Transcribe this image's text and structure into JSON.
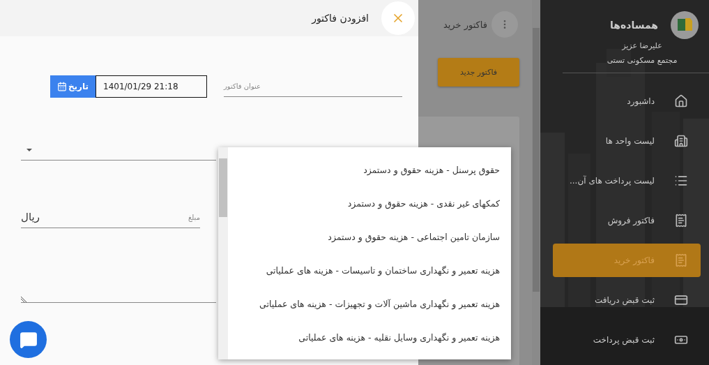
{
  "drawer": {
    "title": "افزودن فاکتور",
    "title_field": {
      "placeholder": "عنوان فاکتور"
    },
    "date_field": {
      "value": "1401/01/29 21:18",
      "button": "تاریخ"
    },
    "amount_field": {
      "label": "مبلغ",
      "value": "ریال"
    }
  },
  "dropdown": {
    "options": [
      {
        "label": "حقوق پرسنل - هزینه حقوق و دستمزد",
        "selected": false
      },
      {
        "label": "کمکهای غیر نقدی - هزینه حقوق و دستمزد",
        "selected": false
      },
      {
        "label": "سازمان تامین اجتماعی - هزینه حقوق و دستمزد",
        "selected": false
      },
      {
        "label": "هزینه تعمیر و نگهداری ساختمان و تاسیسات - هزینه های عملیاتی",
        "selected": false
      },
      {
        "label": "هزینه تعمیر و نگهداری ماشین آلات و تجهیزات - هزینه های عملیاتی",
        "selected": false
      },
      {
        "label": "هزینه تعمیر و نگهداری وسایل نقلیه - هزینه های عملیاتی",
        "selected": false
      }
    ]
  },
  "page": {
    "title": "فاکتور خرید",
    "new_button": "فاکتور جدید"
  },
  "sidebar": {
    "app_name": "همساده‌ها",
    "user_name": "علیرضا عزیز",
    "complex_name": "مجتمع مسکونی تستی",
    "items": [
      {
        "label": "داشبورد",
        "kind": "home",
        "selected": false
      },
      {
        "label": "لیست واحد ها",
        "kind": "building",
        "selected": false
      },
      {
        "label": "لیست پرداخت های آن...",
        "kind": "list",
        "selected": false
      },
      {
        "label": "فاکتور فروش",
        "kind": "receipt",
        "selected": false
      },
      {
        "label": "فاکتور خرید",
        "kind": "receipt",
        "selected": true
      },
      {
        "label": "ثبت قبض دریافت",
        "kind": "card",
        "selected": false
      },
      {
        "label": "ثبت قبض پرداخت",
        "kind": "cash",
        "selected": false
      }
    ]
  }
}
